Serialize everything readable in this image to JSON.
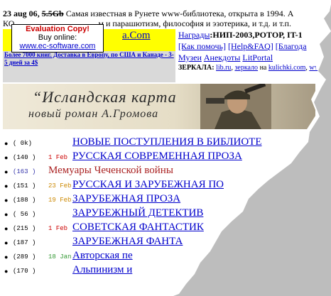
{
  "header": {
    "date": "23 aug 06",
    "size_fragment": "5.5Gb",
    "line1_rest": "Самая известная в Рунете www-библиотека, открыта в 1994. А",
    "line2_left": "КО",
    "line2_rest": "м и парашютизм, философия и эзотерика, и т.д. и т.п.",
    "site_title": "a.Com",
    "promo_text": "Более 7000 книг. Доставка в Европу, по США и Канаде - 3-5 дней за 4$"
  },
  "evaluation_popup": {
    "title": "Evaluation Copy!",
    "subtitle": "Buy online:",
    "link": "www.ec-software.com"
  },
  "right_links": {
    "row1_link": "Награды",
    "row1_rest": ":НИП-2003,РОТОР, IT-1",
    "row2": [
      "[Как помочь]",
      "[Help&FAQ]",
      "[Благода"
    ],
    "row3": [
      "Музеи",
      "Анекдоты",
      "LitPortal"
    ],
    "mirrors_label": "ЗЕРКАЛА",
    "mirrors": [
      "lib.ru",
      "зеркало",
      "на",
      "kulichki.com",
      "ww"
    ]
  },
  "banner": {
    "title": "“Исландская карта",
    "subtitle": "новый роман А.Громова"
  },
  "sections": [
    {
      "count": "(   0k)",
      "date": "",
      "label": "НОВЫЕ ПОСТУПЛЕНИЯ В БИБЛИОТЕ",
      "style": "link"
    },
    {
      "count": "(140 )",
      "date": "1 Feb",
      "label": "РУССКАЯ СОВРЕМЕННАЯ ПРОЗА",
      "style": "link"
    },
    {
      "count": "(163 )",
      "date": "",
      "label": "Мемуары Чеченской войны",
      "style": "red"
    },
    {
      "count": "(151 )",
      "date": "23 Feb",
      "label": "РУССКАЯ И ЗАРУБЕЖНАЯ ПО",
      "style": "link"
    },
    {
      "count": "(188 )",
      "date": "19 Feb",
      "label": "ЗАРУБЕЖНАЯ ПРОЗА",
      "style": "link"
    },
    {
      "count": "( 56 )",
      "date": "",
      "label": "ЗАРУБЕЖНЫЙ ДЕТЕКТИВ",
      "style": "link"
    },
    {
      "count": "(215 )",
      "date": "1 Feb",
      "label": "СОВЕТСКАЯ ФАНТАСТИК",
      "style": "link"
    },
    {
      "count": "(187 )",
      "date": "",
      "label": "ЗАРУБЕЖНАЯ ФАНТА",
      "style": "link"
    },
    {
      "count": "(289 )",
      "date": "18 Jan",
      "label": "Авторская пе",
      "style": "link"
    },
    {
      "count": "(170 )",
      "date": "",
      "label": "Альпинизм и",
      "style": "link"
    }
  ],
  "colors": {
    "link": "#0000cc",
    "yellow": "#ffff00",
    "red_item": "#aa2222",
    "date_red": "#cc0000",
    "date_orange": "#cc8800",
    "date_green": "#339933"
  }
}
